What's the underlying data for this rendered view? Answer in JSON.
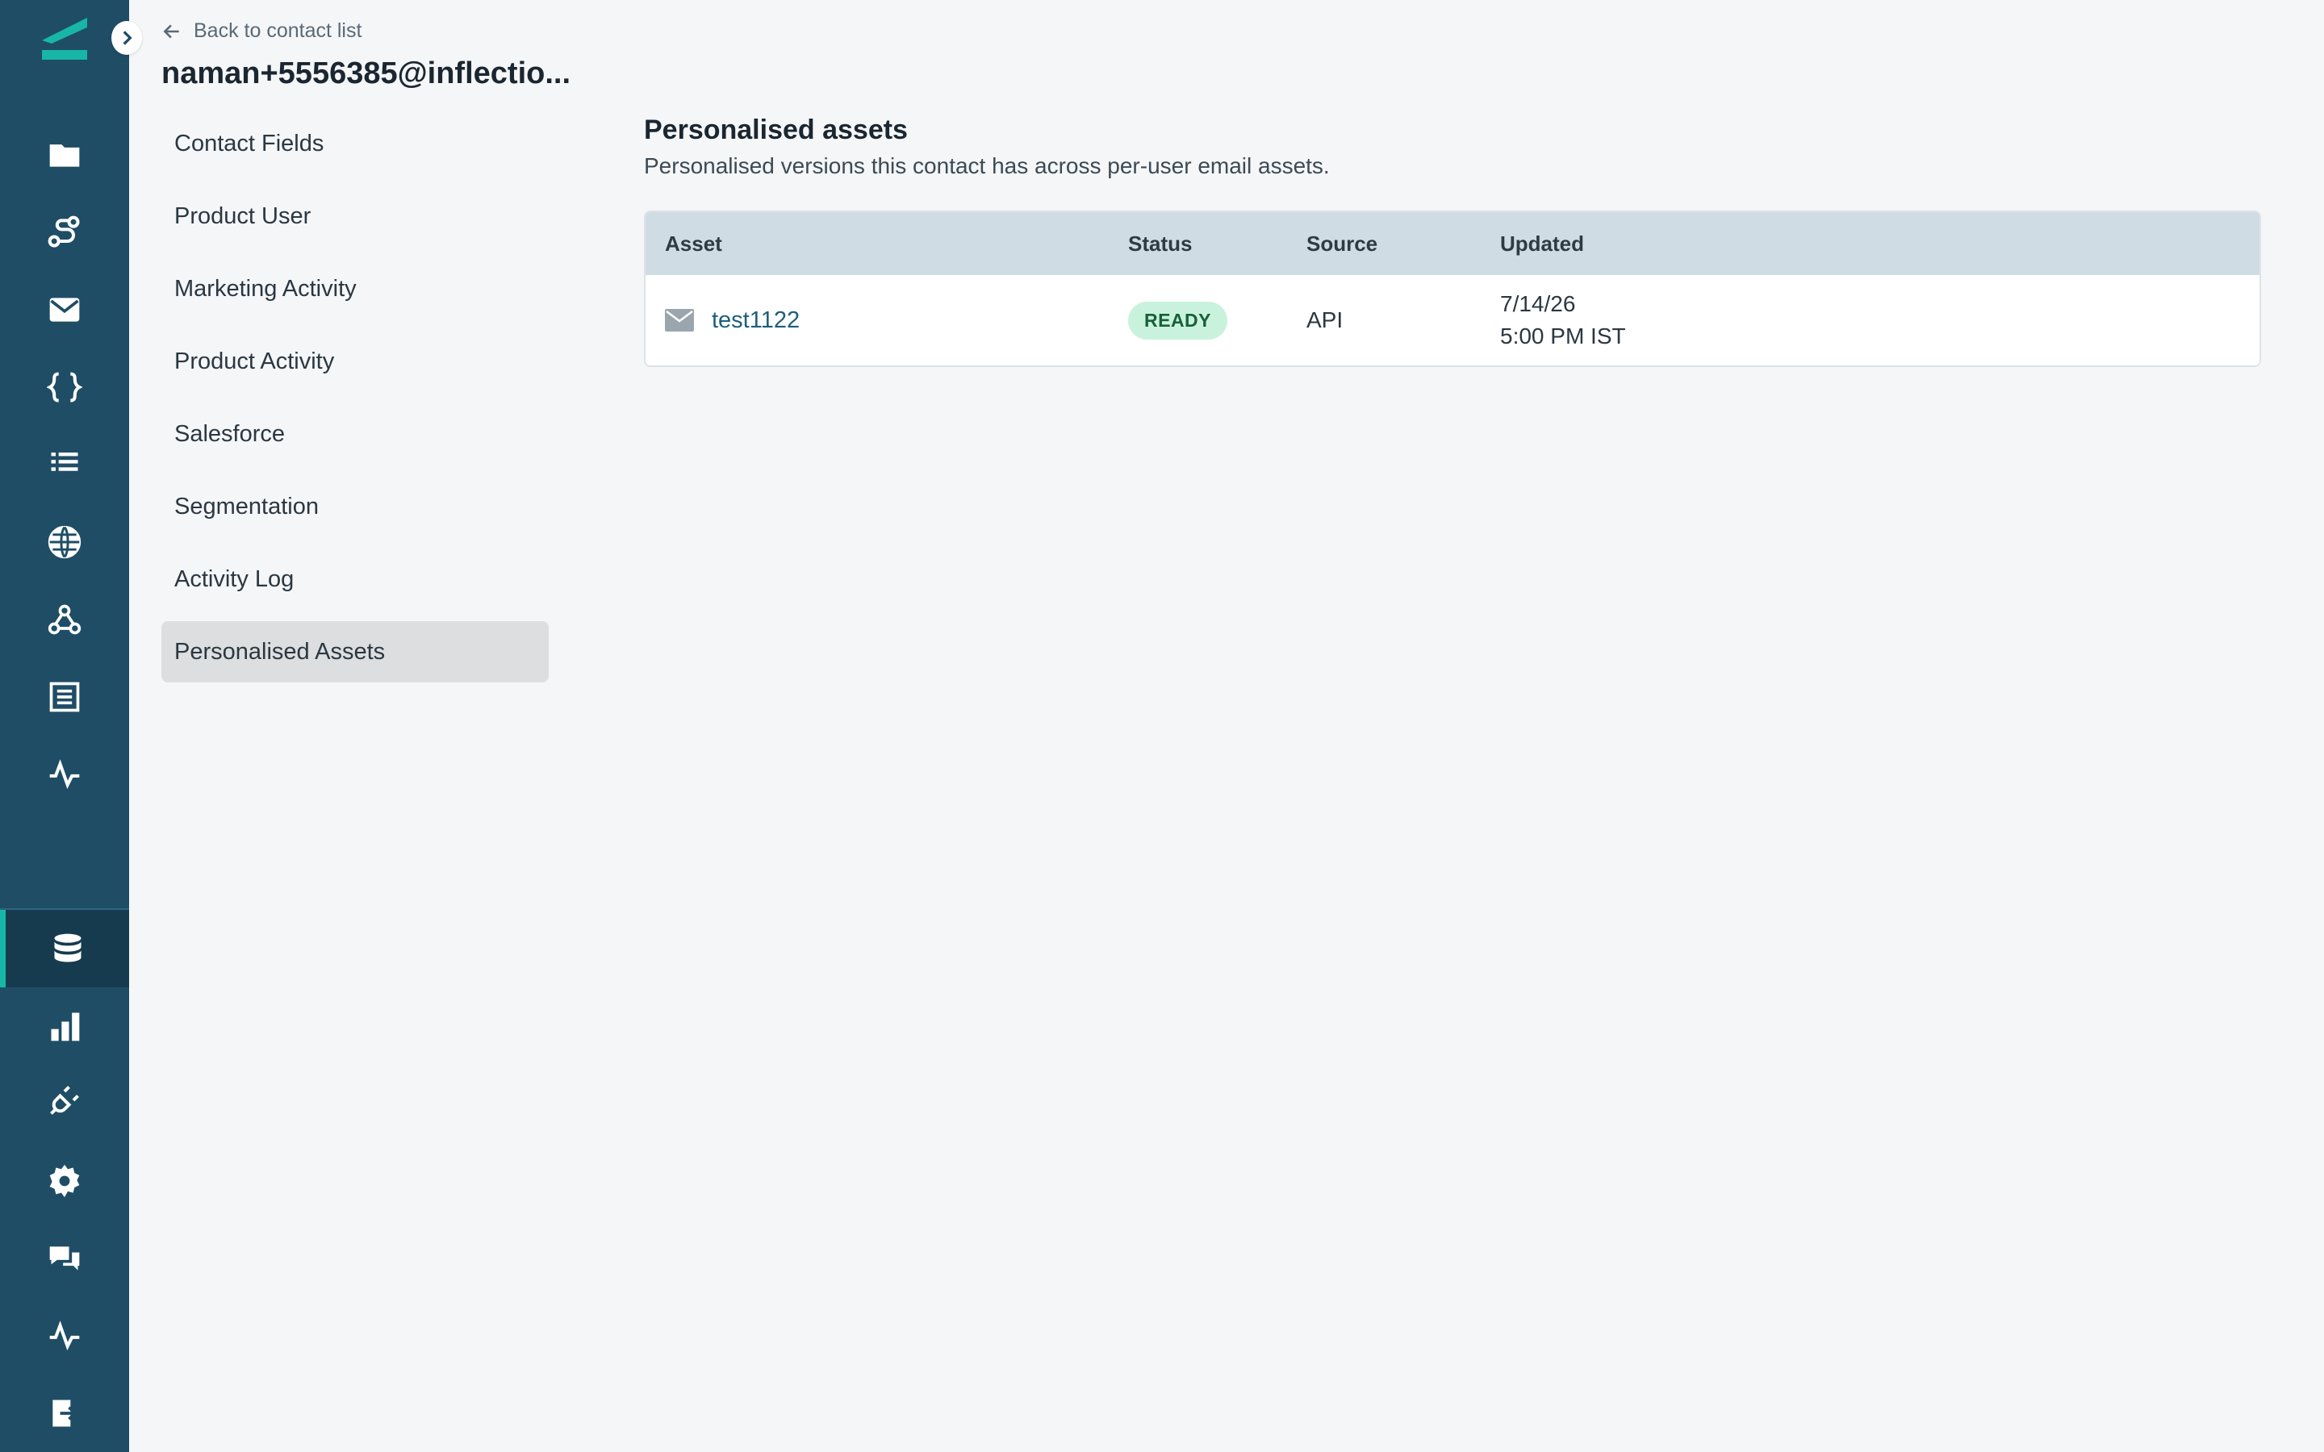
{
  "header": {
    "back_label": "Back to contact list",
    "title": "naman+5556385@inflectio..."
  },
  "subnav": {
    "items": [
      {
        "label": "Contact Fields"
      },
      {
        "label": "Product User"
      },
      {
        "label": "Marketing Activity"
      },
      {
        "label": "Product Activity"
      },
      {
        "label": "Salesforce"
      },
      {
        "label": "Segmentation"
      },
      {
        "label": "Activity Log"
      },
      {
        "label": "Personalised Assets"
      }
    ],
    "selected": "Personalised Assets"
  },
  "section": {
    "title": "Personalised assets",
    "description": "Personalised versions this contact has across per-user email assets."
  },
  "table": {
    "columns": [
      "Asset",
      "Status",
      "Source",
      "Updated"
    ],
    "rows": [
      {
        "asset": "test1122",
        "asset_icon": "mail-icon",
        "status": "READY",
        "source": "API",
        "updated_date": "7/14/26",
        "updated_time": "5:00 PM IST"
      }
    ]
  },
  "rail": {
    "icons": [
      "folder-icon",
      "journey-icon",
      "mail-icon",
      "braces-icon",
      "list-icon",
      "globe-icon",
      "webhook-icon",
      "table-icon",
      "activity-icon",
      "database-icon",
      "bar-chart-icon",
      "plug-icon",
      "gear-icon",
      "chat-icon",
      "pulse-icon",
      "logout-icon"
    ],
    "active": "database-icon"
  },
  "colors": {
    "rail_bg": "#1f4d66",
    "rail_active_bg": "#163b4f",
    "accent": "#18b6a6",
    "badge_bg": "#c9f2dc",
    "badge_text": "#17603a",
    "table_header_bg": "#cfdce3"
  }
}
